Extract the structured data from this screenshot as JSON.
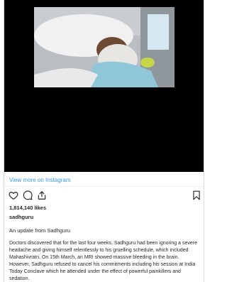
{
  "post": {
    "view_more_label": "View more on Instagram",
    "likes_text": "1,814,140 likes",
    "username": "sadhguru",
    "caption_title": "An update from Sadhguru",
    "caption_body": "Doctors discovered that for the last four weeks, Sadhguru had been ignoring a severe headache and giving himself relentlessly to his gruelling schedule, which included Mahashivratri. On 15th March, an MRI showed massive bleeding in the brain. However, Sadhguru refused to cancel his commitments including his session at India Today Conclave which he attended under the effect of powerful painkillers and sedation."
  },
  "icons": {
    "like": "heart-icon",
    "comment": "comment-icon",
    "share": "share-icon",
    "save": "bookmark-icon"
  },
  "colors": {
    "link": "#3897f0",
    "text": "#262626",
    "media_background": "#000000"
  }
}
